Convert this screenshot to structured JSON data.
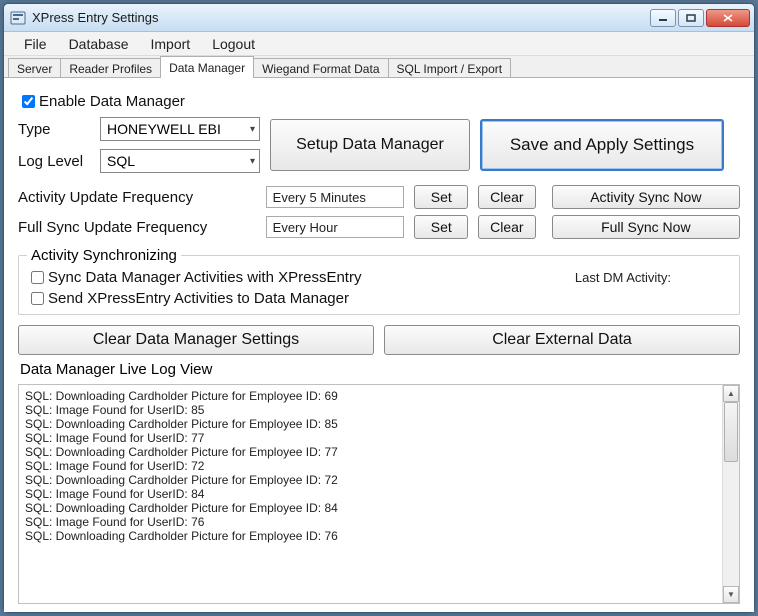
{
  "window": {
    "title": "XPress Entry Settings"
  },
  "menubar": {
    "items": [
      "File",
      "Database",
      "Import",
      "Logout"
    ]
  },
  "tabs": {
    "items": [
      "Server",
      "Reader Profiles",
      "Data Manager",
      "Wiegand Format Data",
      "SQL Import / Export"
    ],
    "activeIndex": 2
  },
  "enable": {
    "label": "Enable Data Manager",
    "checked": true
  },
  "typeRow": {
    "label": "Type",
    "value": "HONEYWELL EBI"
  },
  "logLevel": {
    "label": "Log Level",
    "value": "SQL"
  },
  "buttons": {
    "setup": "Setup Data Manager",
    "save": "Save and Apply Settings",
    "set": "Set",
    "clear": "Clear",
    "activitySync": "Activity Sync Now",
    "fullSync": "Full Sync Now",
    "clearSettings": "Clear Data Manager Settings",
    "clearExternal": "Clear External Data"
  },
  "freq": {
    "activityLabel": "Activity Update Frequency",
    "activityValue": "Every 5 Minutes",
    "fullLabel": "Full Sync Update Frequency",
    "fullValue": "Every Hour"
  },
  "syncGroup": {
    "legend": "Activity Synchronizing",
    "opt1": "Sync Data Manager Activities with XPressEntry",
    "opt2": "Send XPressEntry Activities to Data Manager",
    "lastDm": "Last DM Activity:"
  },
  "logLabel": "Data Manager Live Log View",
  "logLines": [
    "SQL: Downloading Cardholder Picture for Employee ID: 69",
    "SQL: Image Found for UserID: 85",
    "SQL: Downloading Cardholder Picture for Employee ID: 85",
    "SQL: Image Found for UserID: 77",
    "SQL: Downloading Cardholder Picture for Employee ID: 77",
    "SQL: Image Found for UserID: 72",
    "SQL: Downloading Cardholder Picture for Employee ID: 72",
    "SQL: Image Found for UserID: 84",
    "SQL: Downloading Cardholder Picture for Employee ID: 84",
    "SQL: Image Found for UserID: 76",
    "SQL: Downloading Cardholder Picture for Employee ID: 76"
  ]
}
